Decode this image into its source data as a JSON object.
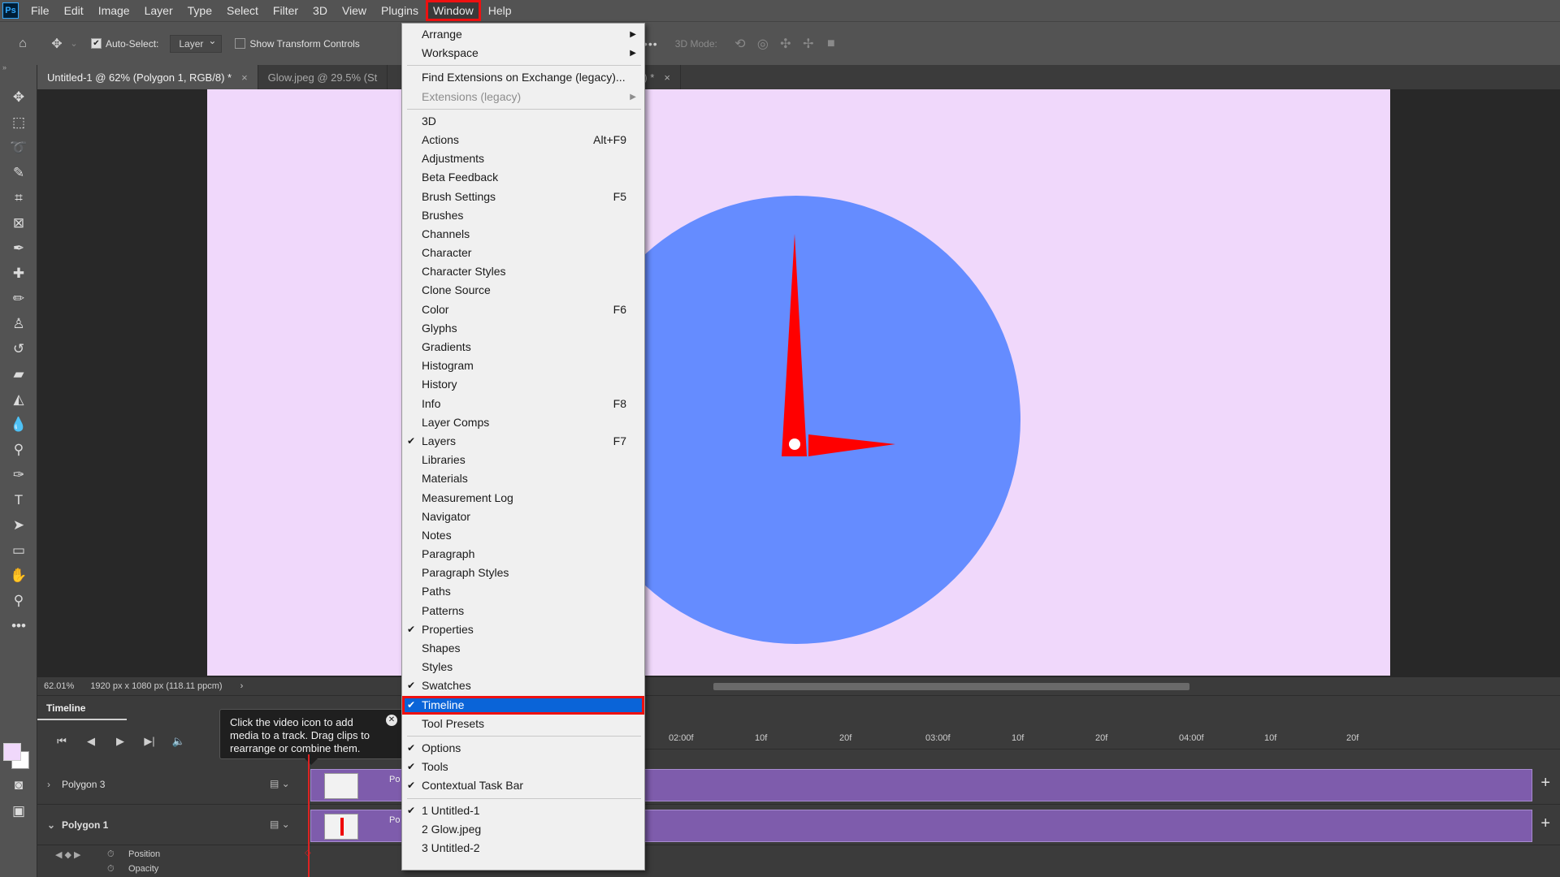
{
  "app": {
    "logo": "Ps"
  },
  "menubar": {
    "items": [
      "File",
      "Edit",
      "Image",
      "Layer",
      "Type",
      "Select",
      "Filter",
      "3D",
      "View",
      "Plugins",
      "Window",
      "Help"
    ],
    "active": "Window"
  },
  "options": {
    "auto_select_label": "Auto-Select:",
    "auto_select_target": "Layer",
    "show_transform_label": "Show Transform Controls",
    "more_label": "•••",
    "mode_3d_label": "3D Mode:"
  },
  "tabs": [
    {
      "label": "Untitled-1 @ 62% (Polygon 1, RGB/8) *",
      "close": "×"
    },
    {
      "label": "Glow.jpeg @ 29.5% (St",
      "close": ""
    },
    {
      "label": "8/8) *",
      "close": "×"
    }
  ],
  "status": {
    "zoom": "62.01%",
    "doc_info": "1920 px x 1080 px (118.11 ppcm)",
    "arrow": "›"
  },
  "canvas": {
    "background": "#f0d8fb",
    "clock_color": "#658cff",
    "hand_color": "#ff0000"
  },
  "timeline": {
    "title": "Timeline",
    "tooltip": "Click the video icon to add media to a track. Drag clips to rearrange or combine them.",
    "ruler_ticks": [
      "10f",
      "20f",
      "02:00f",
      "10f",
      "20f",
      "03:00f",
      "10f",
      "20f",
      "04:00f",
      "10f",
      "20f"
    ],
    "ruler_ticks_left": [
      "10f"
    ],
    "tracks": [
      {
        "name": "Polygon 3",
        "clip_label": "Po"
      },
      {
        "name": "Polygon 1",
        "clip_label": "Po"
      }
    ],
    "properties": [
      "Position",
      "Opacity"
    ]
  },
  "window_menu": {
    "group1": [
      {
        "label": "Arrange",
        "submenu": "▶"
      },
      {
        "label": "Workspace",
        "submenu": "▶"
      }
    ],
    "group2": [
      {
        "label": "Find Extensions on Exchange (legacy)..."
      },
      {
        "label": "Extensions (legacy)",
        "submenu": "▶",
        "disabled": true
      }
    ],
    "group3": [
      {
        "label": "3D",
        "shortcut": "",
        "checked": false
      },
      {
        "label": "Actions",
        "shortcut": "Alt+F9",
        "checked": false
      },
      {
        "label": "Adjustments",
        "shortcut": "",
        "checked": false
      },
      {
        "label": "Beta Feedback",
        "shortcut": "",
        "checked": false
      },
      {
        "label": "Brush Settings",
        "shortcut": "F5",
        "checked": false
      },
      {
        "label": "Brushes",
        "shortcut": "",
        "checked": false
      },
      {
        "label": "Channels",
        "shortcut": "",
        "checked": false
      },
      {
        "label": "Character",
        "shortcut": "",
        "checked": false
      },
      {
        "label": "Character Styles",
        "shortcut": "",
        "checked": false
      },
      {
        "label": "Clone Source",
        "shortcut": "",
        "checked": false
      },
      {
        "label": "Color",
        "shortcut": "F6",
        "checked": false
      },
      {
        "label": "Glyphs",
        "shortcut": "",
        "checked": false
      },
      {
        "label": "Gradients",
        "shortcut": "",
        "checked": false
      },
      {
        "label": "Histogram",
        "shortcut": "",
        "checked": false
      },
      {
        "label": "History",
        "shortcut": "",
        "checked": false
      },
      {
        "label": "Info",
        "shortcut": "F8",
        "checked": false
      },
      {
        "label": "Layer Comps",
        "shortcut": "",
        "checked": false
      },
      {
        "label": "Layers",
        "shortcut": "F7",
        "checked": true
      },
      {
        "label": "Libraries",
        "shortcut": "",
        "checked": false
      },
      {
        "label": "Materials",
        "shortcut": "",
        "checked": false
      },
      {
        "label": "Measurement Log",
        "shortcut": "",
        "checked": false
      },
      {
        "label": "Navigator",
        "shortcut": "",
        "checked": false
      },
      {
        "label": "Notes",
        "shortcut": "",
        "checked": false
      },
      {
        "label": "Paragraph",
        "shortcut": "",
        "checked": false
      },
      {
        "label": "Paragraph Styles",
        "shortcut": "",
        "checked": false
      },
      {
        "label": "Paths",
        "shortcut": "",
        "checked": false
      },
      {
        "label": "Patterns",
        "shortcut": "",
        "checked": false
      },
      {
        "label": "Properties",
        "shortcut": "",
        "checked": true
      },
      {
        "label": "Shapes",
        "shortcut": "",
        "checked": false
      },
      {
        "label": "Styles",
        "shortcut": "",
        "checked": false
      },
      {
        "label": "Swatches",
        "shortcut": "",
        "checked": true
      },
      {
        "label": "Timeline",
        "shortcut": "",
        "checked": true,
        "highlighted": true
      },
      {
        "label": "Tool Presets",
        "shortcut": "",
        "checked": false
      }
    ],
    "group4": [
      {
        "label": "Options",
        "checked": true
      },
      {
        "label": "Tools",
        "checked": true
      },
      {
        "label": "Contextual Task Bar",
        "checked": true
      }
    ],
    "group5": [
      {
        "label": "1 Untitled-1",
        "checked": true
      },
      {
        "label": "2 Glow.jpeg",
        "checked": false
      },
      {
        "label": "3 Untitled-2",
        "checked": false
      }
    ],
    "check_glyph": "✔"
  }
}
